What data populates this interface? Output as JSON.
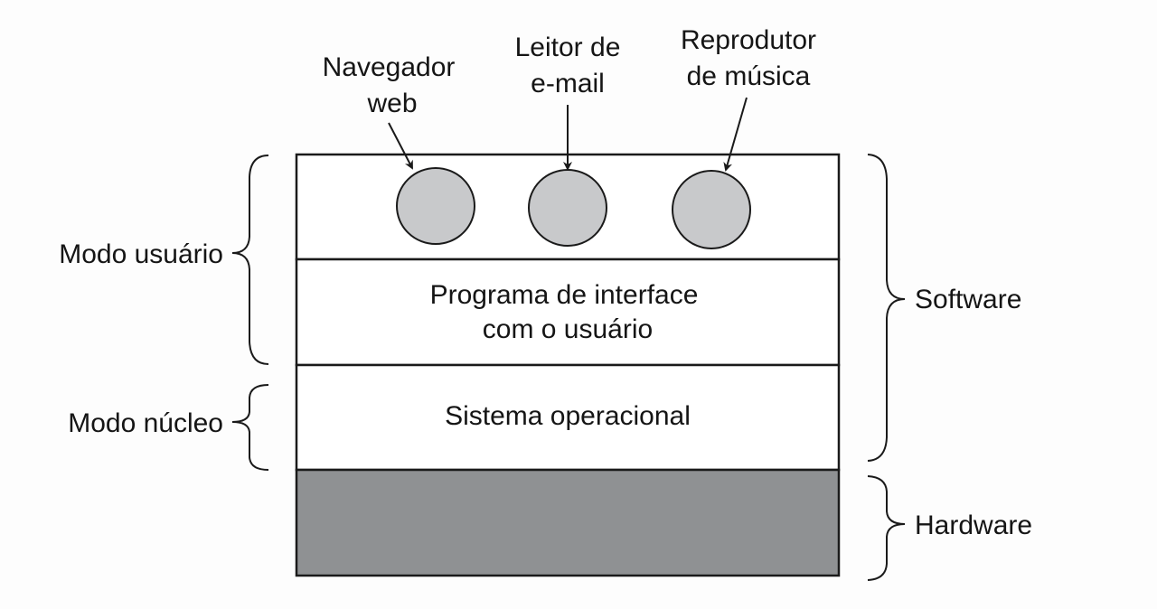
{
  "diagram": {
    "apps": [
      {
        "label_line1": "Navegador",
        "label_line2": "web"
      },
      {
        "label_line1": "Leitor de",
        "label_line2": "e-mail"
      },
      {
        "label_line1": "Reprodutor",
        "label_line2": "de música"
      }
    ],
    "layers": {
      "ui_program_line1": "Programa de interface",
      "ui_program_line2": "com o usuário",
      "os": "Sistema operacional"
    },
    "left_braces": {
      "user_mode": "Modo usuário",
      "kernel_mode": "Modo núcleo"
    },
    "right_braces": {
      "software": "Software",
      "hardware": "Hardware"
    },
    "colors": {
      "app_circle_fill": "#c8c9cb",
      "hardware_fill": "#8f9193",
      "line": "#1a1a1a"
    }
  }
}
